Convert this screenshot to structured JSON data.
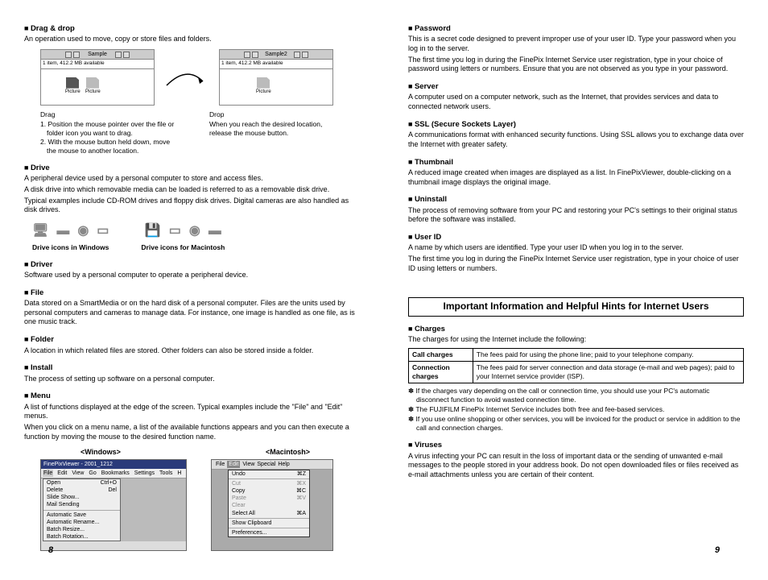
{
  "left": {
    "dragdrop": {
      "title": "Drag & drop",
      "body": "An operation used to move, copy or store files and folders.",
      "win1_title": "Sample",
      "win1_sub": "1 item, 412.2 MB available",
      "win2_title": "Sample2",
      "win2_sub": "1 item, 412.2 MB available",
      "icon_label": "Picture",
      "drag_label": "Drag",
      "drag_step1": "1. Position the mouse pointer over the file or folder icon you want to drag.",
      "drag_step2": "2. With the mouse button held down, move the mouse to another location.",
      "drop_label": "Drop",
      "drop_body": "When you reach the desired location, release the mouse button."
    },
    "drive": {
      "title": "Drive",
      "p1": "A peripheral device used by a personal computer to store and access files.",
      "p2": "A disk drive into which removable media can be loaded is referred to as a removable disk drive.",
      "p3": "Typical examples include CD-ROM drives and floppy disk drives. Digital cameras are also handled as disk drives.",
      "cap_win": "Drive icons in Windows",
      "cap_mac": "Drive icons for Macintosh"
    },
    "driver": {
      "title": "Driver",
      "body": "Software used by a personal computer to operate a peripheral device."
    },
    "file": {
      "title": "File",
      "body": "Data stored on a SmartMedia or on the hard disk of a personal computer. Files are the units used by personal computers and cameras to manage data. For instance, one image is handled as one file, as is one music track."
    },
    "folder": {
      "title": "Folder",
      "body": "A location in which related files are stored. Other folders can also be stored inside a folder."
    },
    "install": {
      "title": "Install",
      "body": "The process of setting up software on a personal computer."
    },
    "menu": {
      "title": "Menu",
      "p1": "A list of functions displayed at the edge of the screen. Typical examples include the \"File\" and \"Edit\" menus.",
      "p2": "When you click on a menu name, a list of the available functions appears and you can then execute a function by moving the mouse to the desired function name.",
      "label_win": "<Windows>",
      "label_mac": "<Macintosh>",
      "win": {
        "title": "FinePixViewer - 2001_1212",
        "menubar": [
          "File",
          "Edit",
          "View",
          "Go",
          "Bookmarks",
          "Settings",
          "Tools",
          "H"
        ],
        "items": [
          {
            "l": "Open",
            "r": "Ctrl+O"
          },
          {
            "l": "Delete",
            "r": "Del"
          },
          {
            "l": "Slide Show...",
            "r": ""
          },
          {
            "l": "Mail Sending",
            "r": ""
          },
          {
            "l": "hr",
            "r": ""
          },
          {
            "l": "Automatic Save",
            "r": ""
          },
          {
            "l": "Automatic Rename...",
            "r": ""
          },
          {
            "l": "Batch Resize...",
            "r": ""
          },
          {
            "l": "Batch Rotation...",
            "r": ""
          }
        ]
      },
      "mac": {
        "menubar": [
          "File",
          "Edit",
          "View",
          "Special",
          "Help"
        ],
        "items": [
          {
            "l": "Undo",
            "r": "⌘Z",
            "on": true
          },
          {
            "l": "hr",
            "r": ""
          },
          {
            "l": "Cut",
            "r": "⌘X",
            "on": false
          },
          {
            "l": "Copy",
            "r": "⌘C",
            "on": true
          },
          {
            "l": "Paste",
            "r": "⌘V",
            "on": false
          },
          {
            "l": "Clear",
            "r": "",
            "on": false
          },
          {
            "l": "Select All",
            "r": "⌘A",
            "on": true
          },
          {
            "l": "hr",
            "r": ""
          },
          {
            "l": "Show Clipboard",
            "r": "",
            "on": true
          },
          {
            "l": "hr",
            "r": ""
          },
          {
            "l": "Preferences...",
            "r": "",
            "on": true
          }
        ]
      }
    },
    "page_num": "8"
  },
  "right": {
    "password": {
      "title": "Password",
      "p1": "This is a secret code designed to prevent improper use of your user ID. Type your password when you log in to the server.",
      "p2": "The first time you log in during the FinePix Internet Service user registration, type in your choice of password using letters or numbers. Ensure that you are not observed as you type in your password."
    },
    "server": {
      "title": "Server",
      "body": "A computer used on a computer network, such as the Internet, that provides services and data to connected network users."
    },
    "ssl": {
      "title": "SSL (Secure Sockets Layer)",
      "body": "A communications format with enhanced security functions. Using SSL allows you to exchange data over the Internet with greater safety."
    },
    "thumbnail": {
      "title": "Thumbnail",
      "body": "A reduced image created when images are displayed as a list. In FinePixViewer, double-clicking on a thumbnail image displays the original image."
    },
    "uninstall": {
      "title": "Uninstall",
      "body": "The process of removing software from your PC and restoring your PC's settings to their original status before the software was installed."
    },
    "userid": {
      "title": "User ID",
      "p1": "A name by which users are identified. Type your user ID when you log in to the server.",
      "p2": "The first time you log in during the FinePix Internet Service user registration, type in your choice of user ID using letters or numbers."
    },
    "section_title": "Important Information and Helpful Hints for Internet Users",
    "charges": {
      "title": "Charges",
      "intro": "The charges for using the Internet include the following:",
      "row1_h": "Call charges",
      "row1_b": "The fees paid for using the phone line; paid to your telephone company.",
      "row2_h": "Connection charges",
      "row2_b": "The fees paid for server connection and data storage (e-mail and web pages); paid to your Internet service provider (ISP).",
      "note1": "If the charges vary depending on the call or connection time, you should use your PC's automatic disconnect function to avoid wasted connection time.",
      "note2": "The FUJIFILM FinePix Internet Service includes both free and fee-based services.",
      "note3": "If you use online shopping or other services, you will be invoiced for the product or service in addition to the call and connection charges."
    },
    "viruses": {
      "title": "Viruses",
      "body": "A virus infecting your PC can result in the loss of important data or the sending of unwanted e-mail messages to the people stored in your address book. Do not open downloaded files or files received as e-mail attachments unless you are certain of their content."
    },
    "page_num": "9"
  }
}
